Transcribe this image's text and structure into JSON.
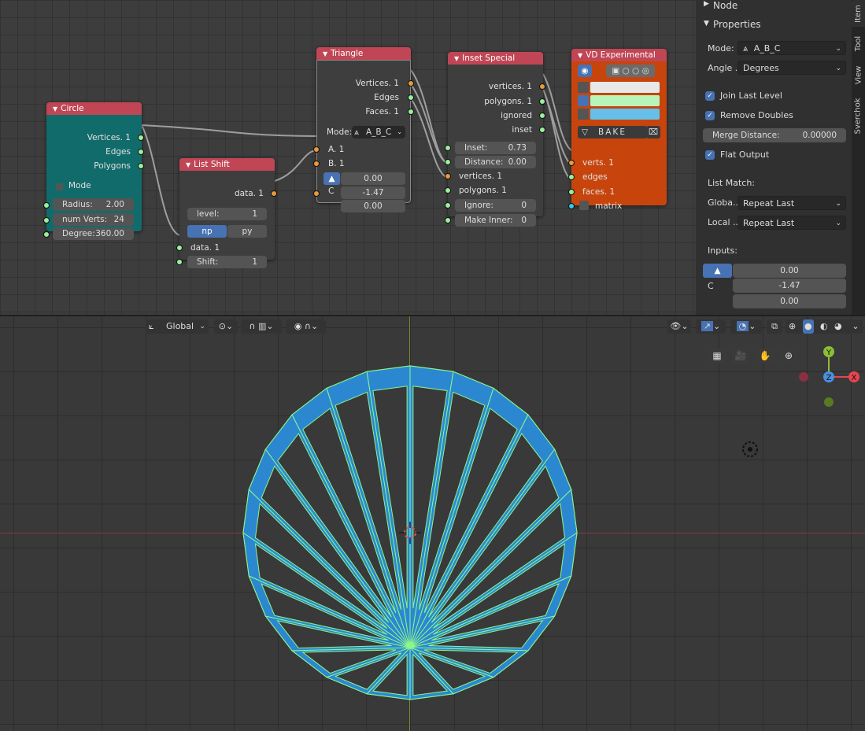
{
  "nodes": {
    "circle": {
      "title": "Circle",
      "outputs": [
        "Vertices. 1",
        "Edges",
        "Polygons"
      ],
      "mode_label": "Mode",
      "fields": [
        {
          "key": "Radius:",
          "value": "2.00"
        },
        {
          "key": "num Verts:",
          "value": "24"
        },
        {
          "key": "Degree:",
          "value": "360.00"
        }
      ]
    },
    "list_shift": {
      "title": "List Shift",
      "output": "data. 1",
      "level_key": "level:",
      "level_value": "1",
      "np_label": "np",
      "py_label": "py",
      "data_input": "data. 1",
      "shift_key": "Shift:",
      "shift_value": "1"
    },
    "triangle": {
      "title": "Triangle",
      "outputs": [
        "Vertices. 1",
        "Edges",
        "Faces. 1"
      ],
      "mode_label": "Mode:",
      "mode_value": "A_B_C",
      "input_a": "A. 1",
      "input_b": "B. 1",
      "input_c": "C",
      "c_values": [
        "0.00",
        "-1.47",
        "0.00"
      ]
    },
    "inset_special": {
      "title": "Inset Special",
      "outputs": [
        "vertices. 1",
        "polygons. 1",
        "ignored",
        "inset"
      ],
      "fields": [
        {
          "key": "Inset:",
          "value": "0.73"
        },
        {
          "key": "Distance:",
          "value": "0.00"
        }
      ],
      "inputs": [
        "vertices. 1",
        "polygons. 1"
      ],
      "fields2": [
        {
          "key": "Ignore:",
          "value": "0"
        },
        {
          "key": "Make Inner:",
          "value": "0"
        }
      ]
    },
    "vd_experimental": {
      "title": "VD Experimental",
      "bake_label": "BAKE",
      "inputs": [
        "verts. 1",
        "edges",
        "faces. 1",
        "matrix"
      ],
      "colors": {
        "vert": "#e8e8e8",
        "edge": "#b8f5b8",
        "face": "#66bfe8"
      }
    }
  },
  "panel": {
    "node_header": "Node",
    "properties_header": "Properties",
    "mode_label": "Mode:",
    "mode_value": "A_B_C",
    "angle_label": "Angle ..",
    "angle_value": "Degrees",
    "join_last_level": "Join Last Level",
    "remove_doubles": "Remove Doubles",
    "merge_label": "Merge Distance:",
    "merge_value": "0.00000",
    "flat_output": "Flat Output",
    "list_match": "List Match:",
    "global_label": "Globa..",
    "global_value": "Repeat Last",
    "local_label": "Local ..",
    "local_value": "Repeat Last",
    "inputs_label": "Inputs:",
    "c_label": "C",
    "c_values": [
      "0.00",
      "-1.47",
      "0.00"
    ]
  },
  "tabs": [
    "Item",
    "Tool",
    "View",
    "Sverchok"
  ],
  "viewport": {
    "orientation": "Global",
    "gizmo": {
      "y": "Y",
      "z": "Z",
      "x": "X"
    },
    "mesh": {
      "segments": 24,
      "fill": "#2b88d0",
      "edge": "#8cf58c"
    }
  }
}
